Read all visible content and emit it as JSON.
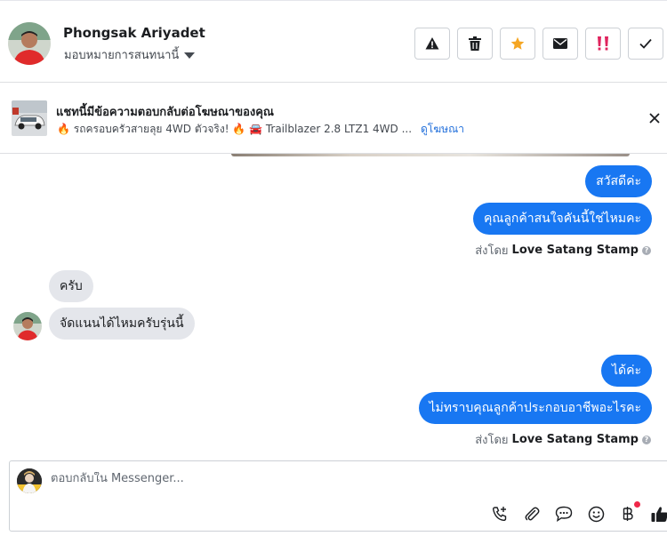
{
  "header": {
    "contact_name": "Phongsak Ariyadet",
    "assign_label": "มอบหมายการสนทนานี้",
    "actions": [
      {
        "name": "spam-button",
        "icon": "warning-icon"
      },
      {
        "name": "delete-button",
        "icon": "trash-icon"
      },
      {
        "name": "star-button",
        "icon": "star-icon",
        "color": "#f5a623"
      },
      {
        "name": "mark-unread-button",
        "icon": "envelope-icon"
      },
      {
        "name": "follow-up-button",
        "icon": "double-exclamation-icon",
        "color": "#e0245e"
      },
      {
        "name": "mark-done-button",
        "icon": "checkmark-icon"
      }
    ]
  },
  "ad": {
    "title": "แชทนี้มีข้อความตอบกลับต่อโฆษณาของคุณ",
    "subtitle": "🔥 รถครอบครัวสายลุย 4WD ตัวจริง! 🔥 🚘 Trailblazer 2.8 LTZ1 4WD ...",
    "view_ad_link": "ดูโฆษณา"
  },
  "messages": {
    "out1": "สวัสดีค่ะ",
    "out2": "คุณลูกค้าสนใจคันนี้ใช่ไหมคะ",
    "sent_by_1": {
      "prefix": "ส่งโดย",
      "sender": "Love Satang Stamp"
    },
    "in1": "ครับ",
    "in2": "จัดแนนได้ไหมครับรุ่นนี้",
    "out3": "ได้ค่ะ",
    "out4": "ไม่ทราบคุณลูกค้าประกอบอาชีพอะไรคะ",
    "sent_by_2": {
      "prefix": "ส่งโดย",
      "sender": "Love Satang Stamp"
    }
  },
  "composer": {
    "placeholder": "ตอบกลับใน Messenger...",
    "tools": [
      "phone-add-icon",
      "paperclip-icon",
      "saved-reply-icon",
      "emoji-icon",
      "baht-icon",
      "thumbs-up-icon"
    ]
  },
  "colors": {
    "accent": "#1877f2",
    "incoming_bubble": "#e4e6eb",
    "link": "#216fdb"
  }
}
